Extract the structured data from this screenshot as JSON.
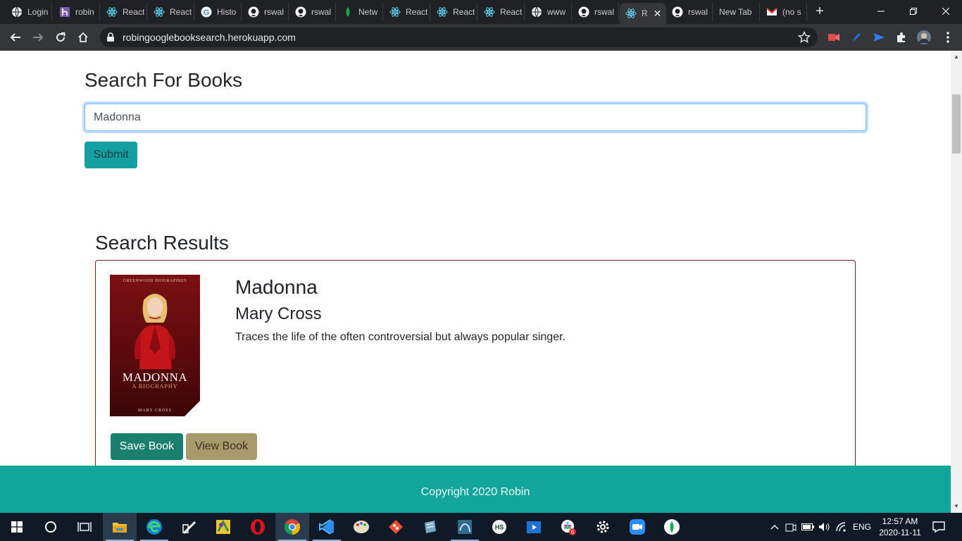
{
  "browser": {
    "tabs": [
      {
        "title": "Login",
        "icon": "globe-icon"
      },
      {
        "title": "robin",
        "icon": "heroku-icon"
      },
      {
        "title": "React",
        "icon": "react-icon"
      },
      {
        "title": "React",
        "icon": "react-icon"
      },
      {
        "title": "Histo",
        "icon": "google-icon"
      },
      {
        "title": "rswal",
        "icon": "github-icon"
      },
      {
        "title": "rswal",
        "icon": "github-icon"
      },
      {
        "title": "Netw",
        "icon": "mongodb-icon"
      },
      {
        "title": "React",
        "icon": "react-icon"
      },
      {
        "title": "React",
        "icon": "react-icon"
      },
      {
        "title": "React",
        "icon": "react-icon"
      },
      {
        "title": "www",
        "icon": "globe-icon"
      },
      {
        "title": "rswal",
        "icon": "github-icon"
      },
      {
        "title": "R",
        "icon": "react-icon",
        "active": true
      },
      {
        "title": "rswal",
        "icon": "github-icon"
      },
      {
        "title": "New Tab",
        "icon": ""
      },
      {
        "title": "(no s",
        "icon": "gmail-icon"
      }
    ],
    "url": "robingooglebooksearch.herokuapp.com"
  },
  "page": {
    "heading": "Search For Books",
    "search": {
      "value": "Madonna"
    },
    "submit_label": "Submit",
    "results_heading": "Search Results",
    "results": [
      {
        "title": "Madonna",
        "author": "Mary Cross",
        "description": "Traces the life of the often controversial but always popular singer.",
        "cover": {
          "series": "GREENWOOD BIOGRAPHIES",
          "name": "MADONNA",
          "subtitle": "A BIOGRAPHY",
          "author": "MARY CROSS"
        },
        "save_label": "Save Book",
        "view_label": "View Book"
      }
    ],
    "footer": "Copyright 2020 Robin"
  },
  "taskbar": {
    "apps": [
      "file-explorer",
      "edge",
      "snip-sketch",
      "sticky-app",
      "opera",
      "chrome",
      "vscode",
      "paint",
      "git",
      "notes-app",
      "mysql-workbench",
      "hs-app",
      "media-player",
      "slack",
      "settings",
      "zoom",
      "mongodb-compass"
    ],
    "language": "ENG",
    "time": "12:57 AM",
    "date": "2020-11-11",
    "slack_badge": "6"
  },
  "colors": {
    "accent_teal": "#149fa1",
    "save_button": "#1b7f6e",
    "view_button": "#a89a6a",
    "card_border": "#7a1f1f",
    "footer": "#12a59b"
  }
}
